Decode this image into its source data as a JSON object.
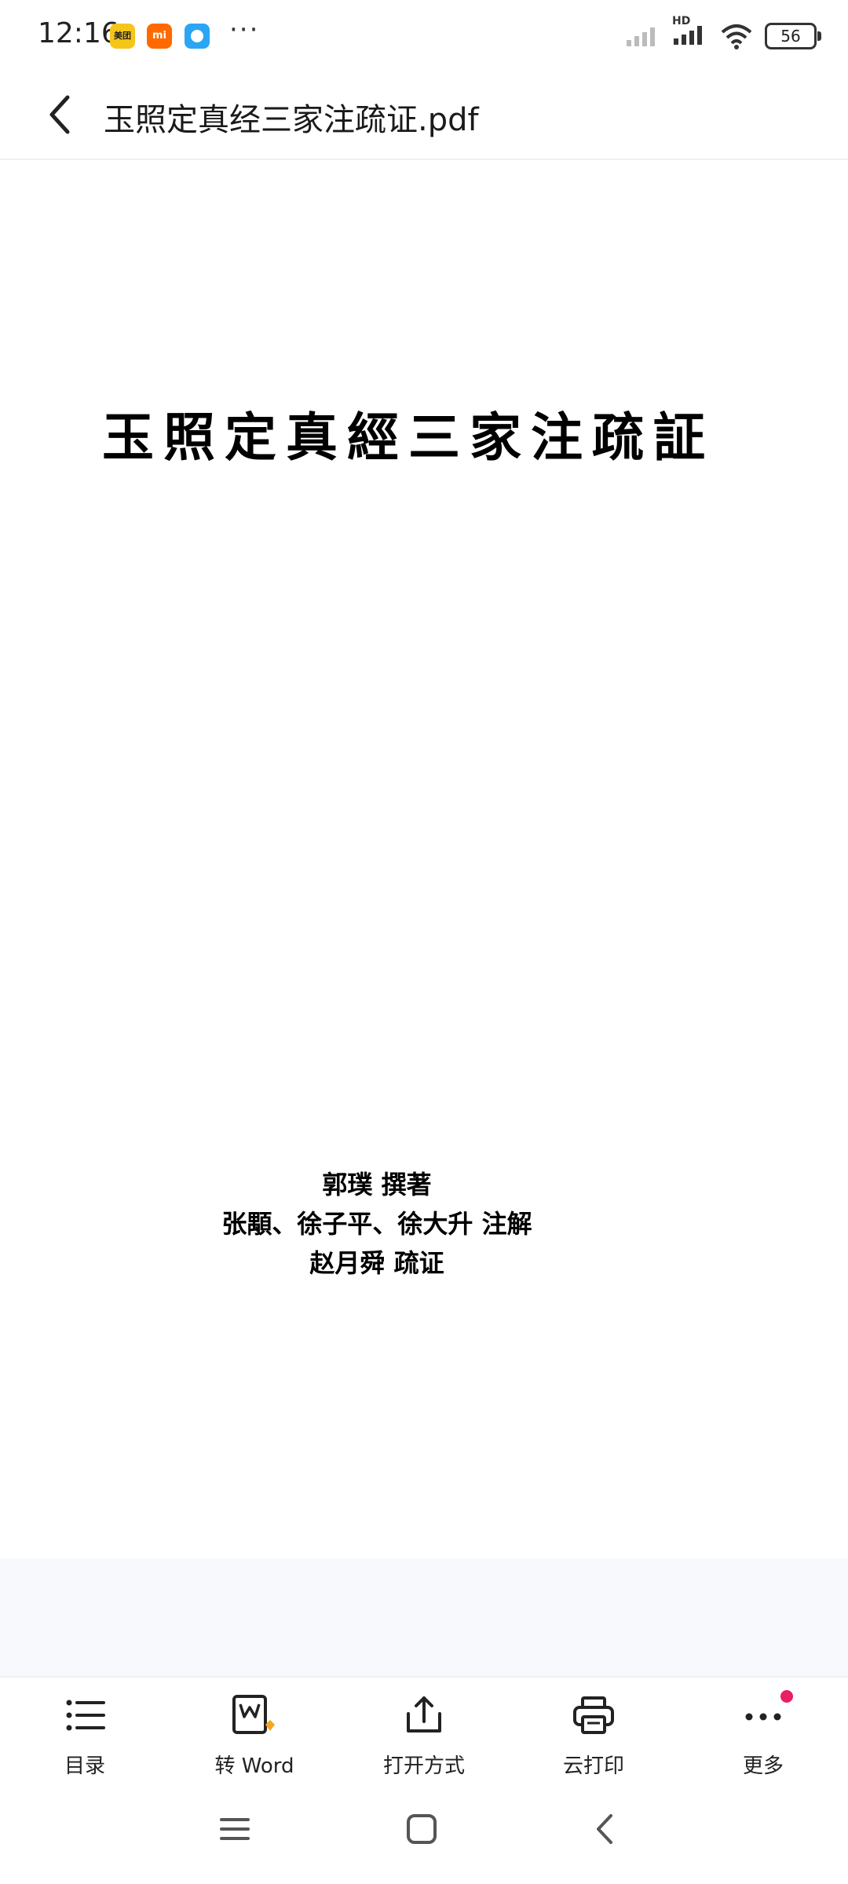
{
  "status_bar": {
    "time": "12:16",
    "app_icons": [
      "美团",
      "mi",
      "chat"
    ],
    "more": "···",
    "network": "HD",
    "battery": "56"
  },
  "header": {
    "title": "玉照定真经三家注疏证.pdf"
  },
  "document": {
    "title": "玉照定真經三家注疏証",
    "credits": [
      "郭璞 撰著",
      "张顒、徐子平、徐大升 注解",
      "赵月舜 疏证"
    ]
  },
  "toolbar": {
    "items": [
      {
        "label": "目录",
        "icon": "list-icon"
      },
      {
        "label": "转 Word",
        "icon": "word-convert-icon"
      },
      {
        "label": "打开方式",
        "icon": "share-icon"
      },
      {
        "label": "云打印",
        "icon": "print-icon"
      },
      {
        "label": "更多",
        "icon": "more-icon"
      }
    ],
    "badge_color": "#e91e63"
  },
  "nav": {
    "items": [
      "menu-icon",
      "home-icon",
      "back-icon"
    ]
  }
}
